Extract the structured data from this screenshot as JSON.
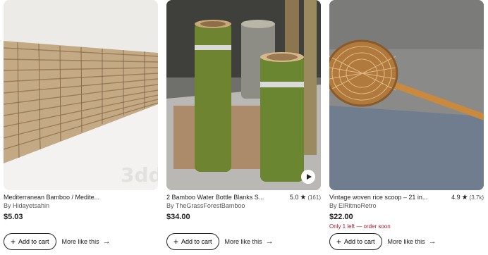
{
  "listings": [
    {
      "title": "Mediterranean Bamboo / Medite...",
      "shop": "By Hidayetsahin",
      "price": "$5.03",
      "add_to_cart": "Add to cart",
      "more_like_this": "More like this",
      "watermark": "3dd"
    },
    {
      "title": "2 Bamboo Water Bottle Blanks S...",
      "rating_score": "5.0",
      "rating_count": "(161)",
      "shop": "By TheGrassForestBamboo",
      "price": "$34.00",
      "add_to_cart": "Add to cart",
      "more_like_this": "More like this",
      "icons": [
        "play-icon"
      ]
    },
    {
      "title": "Vintage woven rice scoop – 21 in...",
      "rating_score": "4.9",
      "rating_count": "(3.7k)",
      "shop": "By ElRitmoRetro",
      "price": "$22.00",
      "stock_note": "Only 1 left — order soon",
      "add_to_cart": "Add to cart",
      "more_like_this": "More like this"
    }
  ],
  "colors": {
    "text": "#222222",
    "muted": "#595959",
    "urgent": "#a61a2e",
    "button_border": "#222222"
  }
}
